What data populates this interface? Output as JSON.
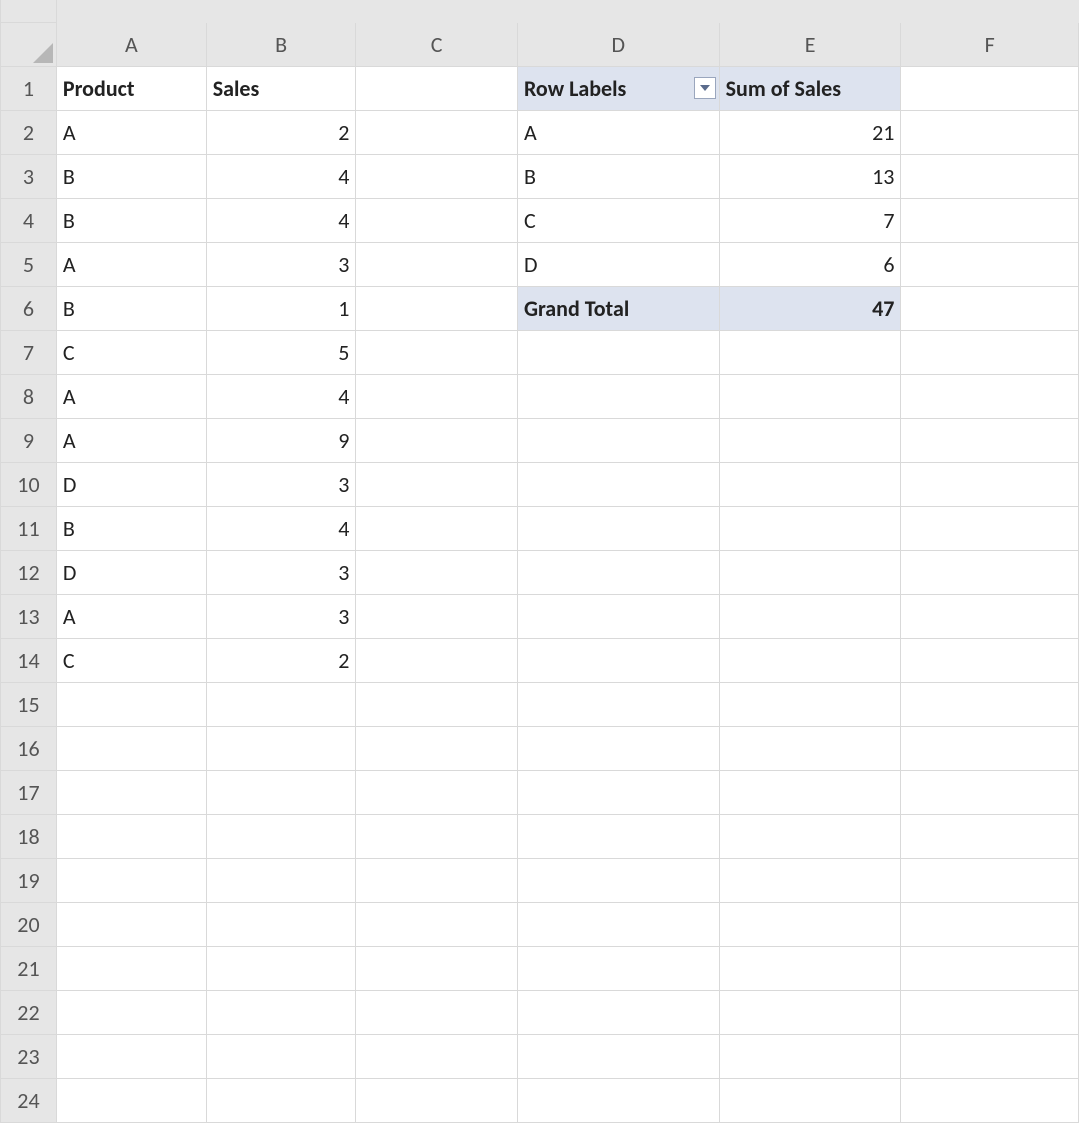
{
  "columns": {
    "A": "A",
    "B": "B",
    "C": "C",
    "D": "D",
    "E": "E",
    "F": "F"
  },
  "rows": {
    "r1": "1",
    "r2": "2",
    "r3": "3",
    "r4": "4",
    "r5": "5",
    "r6": "6",
    "r7": "7",
    "r8": "8",
    "r9": "9",
    "r10": "10",
    "r11": "11",
    "r12": "12",
    "r13": "13",
    "r14": "14",
    "r15": "15",
    "r16": "16",
    "r17": "17",
    "r18": "18",
    "r19": "19",
    "r20": "20",
    "r21": "21",
    "r22": "22",
    "r23": "23",
    "r24": "24"
  },
  "data_table": {
    "headers": {
      "product": "Product",
      "sales": "Sales"
    },
    "rows": [
      {
        "product": "A",
        "sales": "2"
      },
      {
        "product": "B",
        "sales": "4"
      },
      {
        "product": "B",
        "sales": "4"
      },
      {
        "product": "A",
        "sales": "3"
      },
      {
        "product": "B",
        "sales": "1"
      },
      {
        "product": "C",
        "sales": "5"
      },
      {
        "product": "A",
        "sales": "4"
      },
      {
        "product": "A",
        "sales": "9"
      },
      {
        "product": "D",
        "sales": "3"
      },
      {
        "product": "B",
        "sales": "4"
      },
      {
        "product": "D",
        "sales": "3"
      },
      {
        "product": "A",
        "sales": "3"
      },
      {
        "product": "C",
        "sales": "2"
      }
    ]
  },
  "pivot": {
    "row_labels_header": "Row Labels",
    "values_header": "Sum of Sales",
    "rows": [
      {
        "label": "A",
        "value": "21"
      },
      {
        "label": "B",
        "value": "13"
      },
      {
        "label": "C",
        "value": "7"
      },
      {
        "label": "D",
        "value": "6"
      }
    ],
    "grand_total_label": "Grand Total",
    "grand_total_value": "47"
  }
}
